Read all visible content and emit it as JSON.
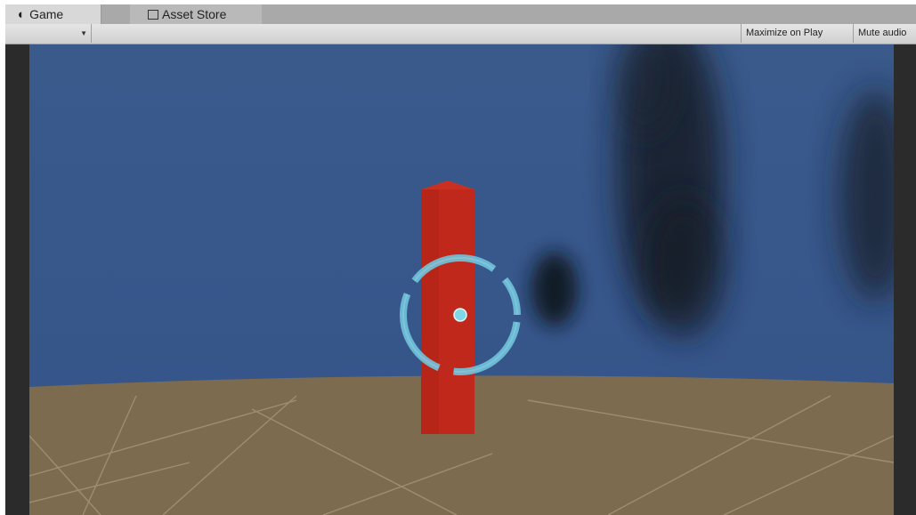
{
  "tabs": [
    {
      "label": "Game",
      "icon": "game-icon",
      "active": true
    },
    {
      "label": "Asset Store",
      "icon": "asset-store-icon",
      "active": false
    }
  ],
  "toolbar": {
    "aspect_dropdown_icon": "chevron-down-icon",
    "maximize_label": "Maximize on Play",
    "mute_label": "Mute audio"
  },
  "scene": {
    "sky_color": "#3b5a8a",
    "ground_color": "#7d6b4f",
    "pillar_color": "#c0281c",
    "reticle_color": "#6fc4dd"
  }
}
